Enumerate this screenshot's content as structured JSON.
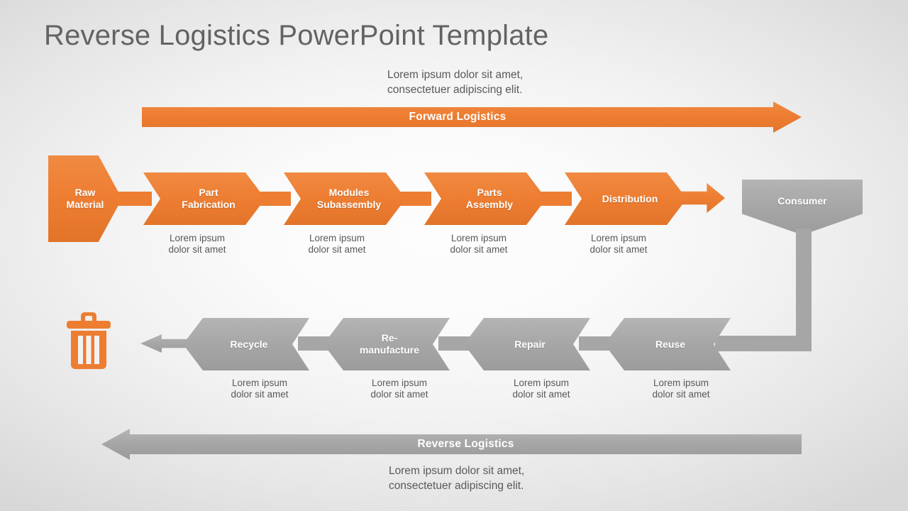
{
  "slide": {
    "title": "Reverse Logistics PowerPoint Template",
    "caption_top": "Lorem ipsum dolor sit amet,\nconsectetuer adipiscing elit.",
    "caption_bottom": "Lorem ipsum dolor sit amet,\nconsectetuer adipiscing elit.",
    "colors": {
      "orange": "#ed7d31",
      "gray": "#a6a6a6",
      "title_text": "#636363",
      "body_text": "#595959",
      "node_text": "#ffffff",
      "background_center": "#fdfdfd",
      "background_edge": "#d9d9d9"
    }
  },
  "banners": {
    "forward": {
      "label": "Forward Logistics",
      "direction": "right"
    },
    "reverse": {
      "label": "Reverse Logistics",
      "direction": "left"
    }
  },
  "forward_flow": {
    "start": {
      "label": "Raw\nMaterial",
      "shape": "pentagon-right"
    },
    "steps": [
      {
        "label": "Part\nFabrication",
        "caption": "Lorem ipsum\ndolor sit amet"
      },
      {
        "label": "Modules\nSubassembly",
        "caption": "Lorem ipsum\ndolor sit amet"
      },
      {
        "label": "Parts\nAssembly",
        "caption": "Lorem ipsum\ndolor sit amet"
      },
      {
        "label": "Distribution",
        "caption": "Lorem ipsum\ndolor sit amet"
      }
    ],
    "end": {
      "label": "Consumer",
      "shape": "pentagon-down"
    }
  },
  "reverse_flow": {
    "steps": [
      {
        "label": "Recycle",
        "caption": "Lorem ipsum\ndolor sit amet"
      },
      {
        "label": "Re-\nmanufacture",
        "caption": "Lorem ipsum\ndolor sit amet"
      },
      {
        "label": "Repair",
        "caption": "Lorem ipsum\ndolor sit amet"
      },
      {
        "label": "Reuse",
        "caption": "Lorem ipsum\ndolor sit amet"
      }
    ],
    "end_icon": "trash-icon"
  }
}
